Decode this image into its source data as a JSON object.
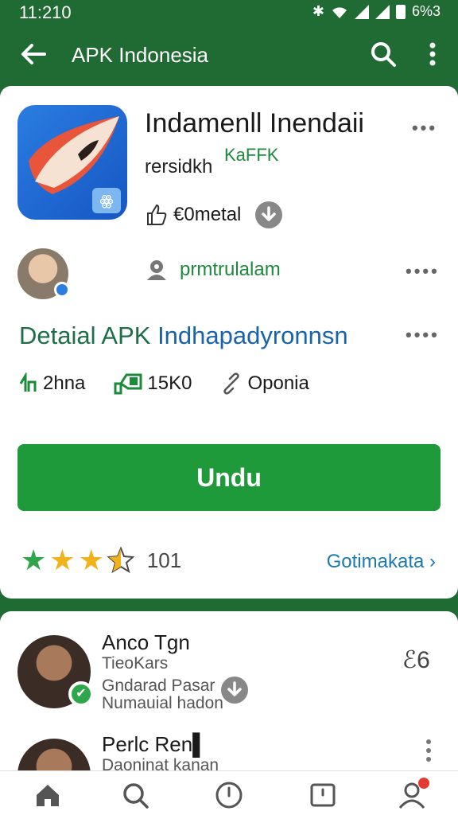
{
  "status_bar": {
    "time": "11:210",
    "battery": "6%3"
  },
  "app_bar": {
    "title": "APK Indonesia"
  },
  "app": {
    "name": "Indamenll Inendaii",
    "version_label": "rersidkh",
    "tag": "KaFFK",
    "likes_label": "€0metal"
  },
  "developer": {
    "name": "prmtrulalam"
  },
  "detail": {
    "title_part1": "Detaial APK",
    "title_part2": "Indhapadyronnsn"
  },
  "stats": [
    {
      "label": "2hna"
    },
    {
      "label": "15K0"
    },
    {
      "label": "Oponia"
    }
  ],
  "download": {
    "label": "Undu"
  },
  "rating": {
    "stars": 3.5,
    "count": "101",
    "more_link": "Gotimakata ›"
  },
  "reviews": [
    {
      "name": "Anco Tgn",
      "subtitle": "TieoKars",
      "line1": "Gndarad Pasar",
      "line2": "Numauial hadon",
      "side_text": "ℰ6"
    },
    {
      "name": "Perlc Ren▌",
      "subtitle": "Daoninat kanan"
    }
  ],
  "colors": {
    "primary_dark": "#1f6b33",
    "accent_green": "#1f9a3b",
    "link_blue": "#1a7ab3",
    "star_gold": "#f2b21b"
  }
}
